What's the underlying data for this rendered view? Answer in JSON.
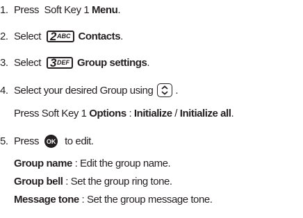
{
  "steps": [
    {
      "num": "1.",
      "text": "Press  Soft Key 1 ",
      "bold": "Menu",
      "end": "."
    },
    {
      "num": "2.",
      "text": "Select",
      "key_digit": "2",
      "key_letters": "ABC",
      "bold": "Contacts",
      "end": "."
    },
    {
      "num": "3.",
      "text": "Select",
      "key_digit": "3",
      "key_letters": "DEF",
      "bold": "Group settings",
      "end": "."
    },
    {
      "num": "4.",
      "text": "Select your desired Group using",
      "nav_icon": "up-down-navigation-key-icon",
      "end": ".",
      "line2": {
        "text": "Press Soft Key 1 ",
        "b1": "Options",
        "sep1": " : ",
        "b2": "Initialize",
        "sep2": " / ",
        "b3": "Initialize all",
        "end": "."
      }
    },
    {
      "num": "5.",
      "text": "Press",
      "ok_label": "OK",
      "after": "to edit.",
      "details": [
        {
          "label": "Group name",
          "sep": " : ",
          "desc": "Edit the group name."
        },
        {
          "label": "Group bell",
          "sep": " : ",
          "desc": "Set the group ring tone."
        },
        {
          "label": "Message tone",
          "sep": " : ",
          "desc": "Set the group message tone."
        }
      ]
    }
  ]
}
